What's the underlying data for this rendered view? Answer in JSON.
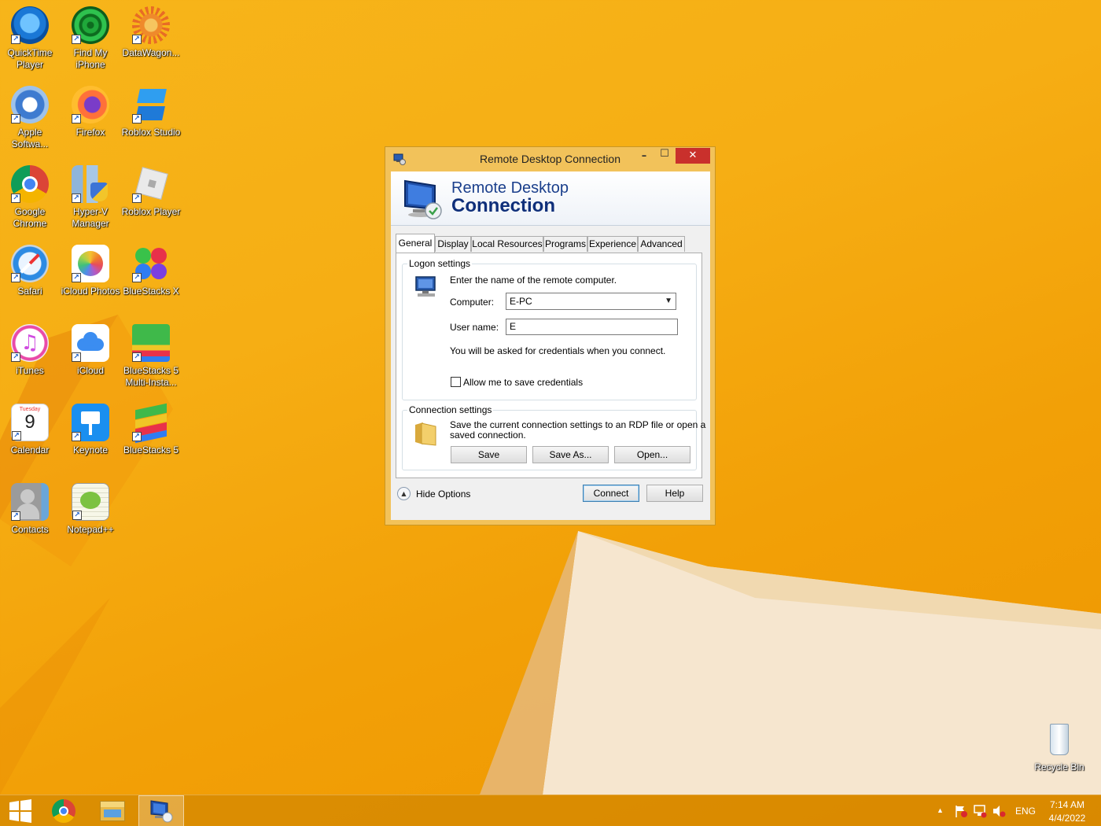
{
  "desktop": {
    "icons": [
      {
        "label": "QuickTime Player"
      },
      {
        "label": "Find My iPhone"
      },
      {
        "label": "DataWagon..."
      },
      {
        "label": "Apple Softwa..."
      },
      {
        "label": "Firefox"
      },
      {
        "label": "Roblox Studio"
      },
      {
        "label": "Google Chrome"
      },
      {
        "label": "Hyper-V Manager"
      },
      {
        "label": "Roblox Player"
      },
      {
        "label": "Safari"
      },
      {
        "label": "iCloud Photos"
      },
      {
        "label": "BlueStacks X"
      },
      {
        "label": "iTunes"
      },
      {
        "label": "iCloud"
      },
      {
        "label": "BlueStacks 5 Multi-Insta..."
      },
      {
        "label": "Calendar"
      },
      {
        "label": "Keynote"
      },
      {
        "label": "BlueStacks 5"
      },
      {
        "label": "Contacts"
      },
      {
        "label": "Notepad++"
      }
    ],
    "calendar_icon": {
      "day_name": "Tuesday",
      "day_number": "9"
    },
    "recycle_bin": {
      "label": "Recycle Bin"
    }
  },
  "window": {
    "title": "Remote Desktop Connection",
    "controls": {
      "minimize": "–",
      "maximize": "☐",
      "close": "✕"
    },
    "banner": {
      "line1": "Remote Desktop",
      "line2": "Connection"
    },
    "tabs": [
      {
        "label": "General"
      },
      {
        "label": "Display"
      },
      {
        "label": "Local Resources"
      },
      {
        "label": "Programs"
      },
      {
        "label": "Experience"
      },
      {
        "label": "Advanced"
      }
    ],
    "logon": {
      "legend": "Logon settings",
      "instruction": "Enter the name of the remote computer.",
      "computer_label": "Computer:",
      "computer_value": "E-PC",
      "username_label": "User name:",
      "username_value": "E",
      "credentials_note": "You will be asked for credentials when you connect.",
      "save_credentials_label": "Allow me to save credentials",
      "save_credentials_checked": false
    },
    "connection": {
      "legend": "Connection settings",
      "description_line1": "Save the current connection settings to an RDP file or open a",
      "description_line2": "saved connection.",
      "save": "Save",
      "save_as": "Save As...",
      "open": "Open..."
    },
    "footer": {
      "hide_options": "Hide Options",
      "connect": "Connect",
      "help": "Help"
    }
  },
  "taskbar": {
    "language": "ENG",
    "time": "7:14 AM",
    "date": "4/4/2022",
    "tray_expand": "▲"
  }
}
